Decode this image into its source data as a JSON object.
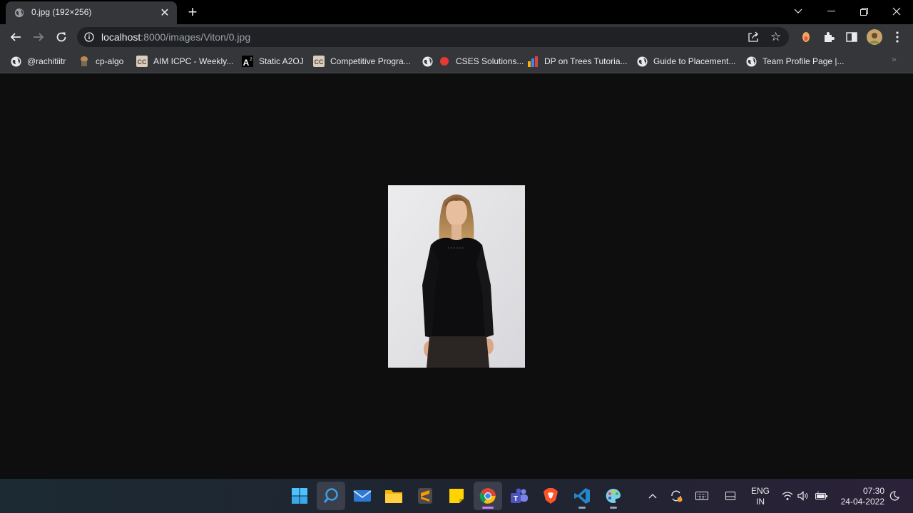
{
  "tab": {
    "title": "0.jpg (192×256)",
    "favicon": "globe-icon",
    "close": "✕"
  },
  "newtab_label": "+",
  "window_controls": [
    "chevron-down-icon",
    "minimize-icon",
    "restore-icon",
    "close-icon"
  ],
  "address": {
    "host": "localhost",
    "path": ":8000/images/Viton/0.jpg"
  },
  "bookmarks": [
    {
      "label": "@rachitiitr",
      "icon": "globe-icon"
    },
    {
      "label": "cp-algo",
      "icon": "cp-algo-icon"
    },
    {
      "label": "AIM ICPC - Weekly...",
      "icon": "codechef-icon"
    },
    {
      "label": "Static A2OJ",
      "icon": "a2oj-icon",
      "badge": "A"
    },
    {
      "label": "Competitive Progra...",
      "icon": "codechef-icon"
    },
    {
      "label": "CSES Solutions...",
      "icon": "red-dot-icon"
    },
    {
      "label": "DP on Trees Tutoria...",
      "icon": "bar-chart-icon"
    },
    {
      "label": "Guide to Placement...",
      "icon": "globe-icon"
    },
    {
      "label": "Team Profile Page |...",
      "icon": "globe-icon"
    }
  ],
  "bookmarks_more": "»",
  "image": {
    "description": "product photo"
  },
  "taskbar": {
    "apps": [
      "start-icon",
      "search-icon",
      "mail-icon",
      "file-explorer-icon",
      "sublime-text-icon",
      "sticky-notes-icon",
      "chrome-icon",
      "teams-icon",
      "brave-icon",
      "vscode-icon",
      "paint-icon"
    ],
    "lang_line1": "ENG",
    "lang_line2": "IN",
    "time": "07:30",
    "date": "24-04-2022"
  },
  "colors": {
    "background": "#0e0e0e",
    "chrome_toolbar": "#35363a",
    "omnibox": "#202124"
  }
}
